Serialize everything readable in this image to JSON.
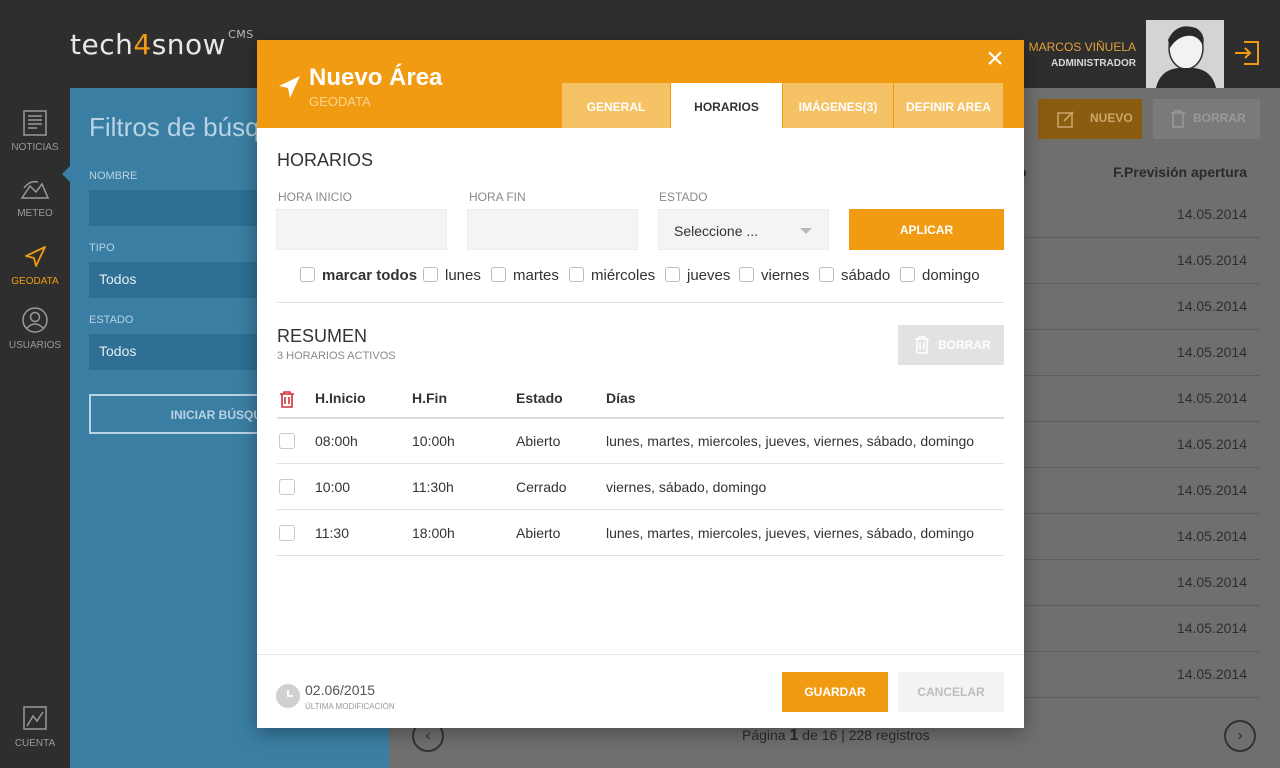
{
  "app": {
    "logo_prefix": "tech",
    "logo_four": "4",
    "logo_suffix": "snow",
    "logo_cms": "CMS"
  },
  "user": {
    "name": "MARCOS VIÑUELA",
    "role": "ADMINISTRADOR"
  },
  "sidebar": {
    "items": [
      {
        "label": "NOTICIAS",
        "icon": "news-icon"
      },
      {
        "label": "METEO",
        "icon": "weather-icon"
      },
      {
        "label": "GEODATA",
        "icon": "navigation-icon",
        "active": true
      },
      {
        "label": "USUARIOS",
        "icon": "user-icon"
      }
    ],
    "account_label": "CUENTA"
  },
  "filters": {
    "title": "Filtros de búsqueda",
    "nombre_label": "NOMBRE",
    "tipo_label": "TIPO",
    "tipo_value": "Todos",
    "estado_label": "ESTADO",
    "estado_value": "Todos",
    "search_button": "INICIAR BÚSQUEDA"
  },
  "list": {
    "nuevo_label": "NUEVO",
    "borrar_label": "BORRAR",
    "col_fragment": "o",
    "col_header": "F.Previsión apertura",
    "dates": [
      "14.05.2014",
      "14.05.2014",
      "14.05.2014",
      "14.05.2014",
      "14.05.2014",
      "14.05.2014",
      "14.05.2014",
      "14.05.2014",
      "14.05.2014",
      "14.05.2014",
      "14.05.2014"
    ],
    "pager_prefix": "Página",
    "pager_current": "1",
    "pager_suffix": "de 16 | 228 registros"
  },
  "modal": {
    "title": "Nuevo Área",
    "subtitle": "GEODATA",
    "tabs": [
      {
        "label": "GENERAL"
      },
      {
        "label": "HORARIOS",
        "active": true
      },
      {
        "label": "IMÁGENES(3)"
      },
      {
        "label": "DEFINIR AREA"
      }
    ],
    "horarios": {
      "title": "HORARIOS",
      "hora_inicio_label": "HORA INICIO",
      "hora_inicio_value": "",
      "hora_fin_label": "HORA FIN",
      "hora_fin_value": "",
      "estado_label": "ESTADO",
      "estado_value": "Seleccione ...",
      "apply_label": "APLICAR",
      "days": [
        "marcar todos",
        "lunes",
        "martes",
        "miércoles",
        "jueves",
        "viernes",
        "sábado",
        "domingo"
      ]
    },
    "resumen": {
      "title": "RESUMEN",
      "subtitle": "3 HORARIOS ACTIVOS",
      "borrar_label": "BORRAR",
      "columns": [
        "H.Inicio",
        "H.Fin",
        "Estado",
        "Días"
      ],
      "rows": [
        {
          "inicio": "08:00h",
          "fin": "10:00h",
          "estado": "Abierto",
          "dias": "lunes, martes, miercoles, jueves, viernes, sábado, domingo"
        },
        {
          "inicio": "10:00",
          "fin": "11:30h",
          "estado": "Cerrado",
          "dias": "viernes, sábado, domingo"
        },
        {
          "inicio": "11:30",
          "fin": "18:00h",
          "estado": "Abierto",
          "dias": "lunes, martes, miercoles, jueves, viernes, sábado, domingo"
        }
      ]
    },
    "footer": {
      "date": "02.06/2015",
      "date_label": "ÚLTIMA MODIFICACIÓN",
      "save_label": "GUARDAR",
      "cancel_label": "CANCELAR"
    }
  },
  "colors": {
    "accent": "#f19b12",
    "sidebar_bg": "#2e2e2e",
    "filters_bg": "#3a7ea3",
    "delete_red": "#d0303a"
  }
}
